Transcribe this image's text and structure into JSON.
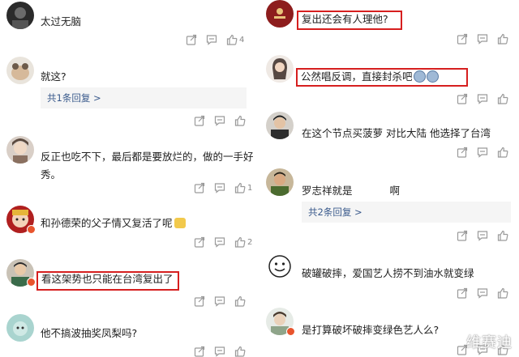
{
  "left": {
    "comments": [
      {
        "text": "太过无脑",
        "like_count": "4"
      },
      {
        "text": "就这?",
        "replies": "共1条回复 >",
        "like_count": ""
      },
      {
        "text_line1": "反正也吃不下，最后都是要放烂的，做的一手好",
        "text_line2": "秀。",
        "like_count": "1"
      },
      {
        "text": "和孙德荣的父子情又复活了呢",
        "like_count": "2"
      },
      {
        "text": "看这架势也只能在台湾复出了",
        "like_count": ""
      },
      {
        "text": "他不搞波抽奖凤梨吗?",
        "like_count": ""
      }
    ]
  },
  "right": {
    "comments": [
      {
        "text": "复出还会有人理他?",
        "like_count": ""
      },
      {
        "text": "公然唱反调，直接封杀吧",
        "like_count": ""
      },
      {
        "text": "在这个节点买菠萝 对比大陆  他选择了台湾",
        "like_count": ""
      },
      {
        "text": "罗志祥就是",
        "text_tail": "啊",
        "replies": "共2条回复 >",
        "like_count": ""
      },
      {
        "text": "破罐破摔，爱国艺人捞不到油水就变绿",
        "like_count": ""
      },
      {
        "text": "是打算破坏破摔变绿色艺人么?",
        "like_count": ""
      }
    ]
  },
  "watermark": "维赛迪",
  "colors": {
    "highlight": "#d61f1f",
    "reply_link": "#3a5a8c",
    "icon": "#9a9a9a"
  }
}
